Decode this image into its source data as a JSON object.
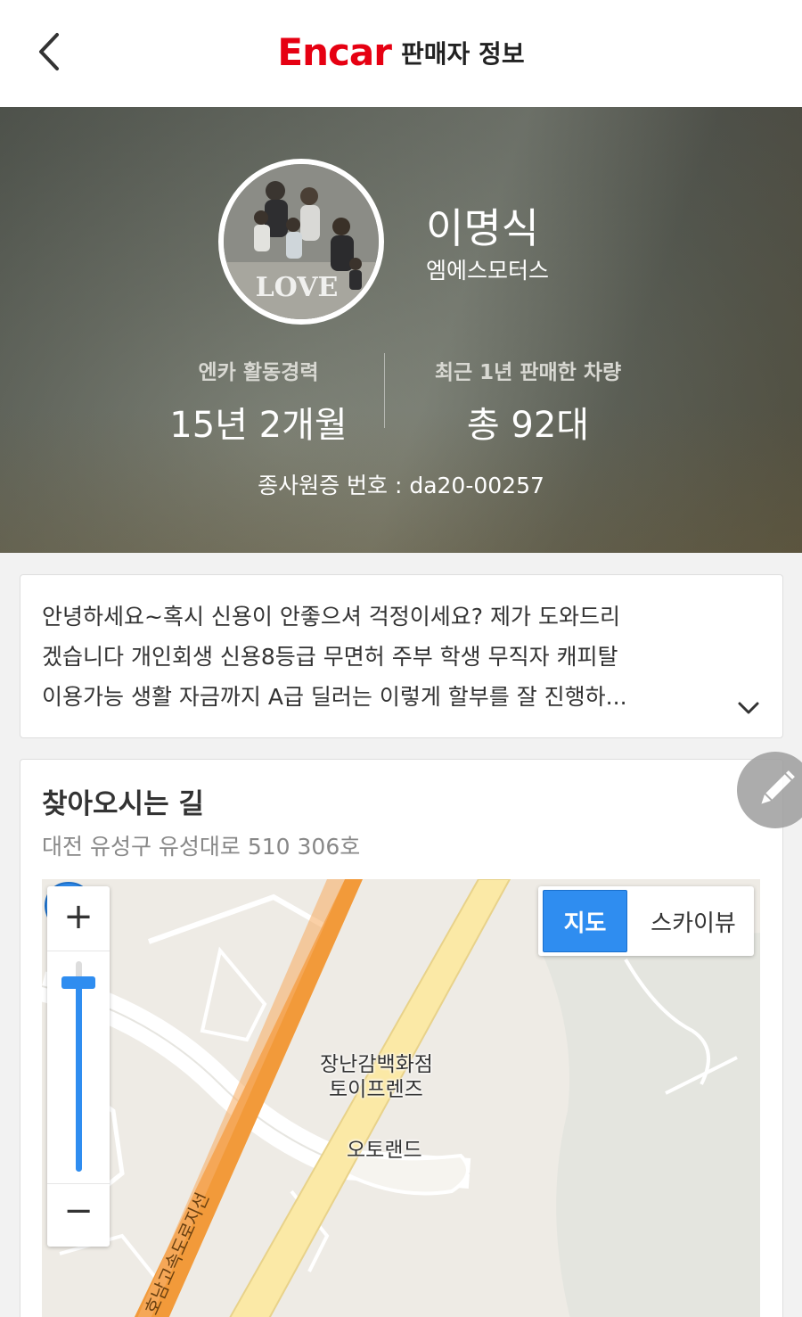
{
  "header": {
    "logo": "Encar",
    "title": "판매자 정보"
  },
  "seller": {
    "name": "이명식",
    "dealer": "엠에스모터스",
    "avatar_caption": "LOVE",
    "stats": [
      {
        "label": "엔카 활동경력",
        "value": "15년 2개월"
      },
      {
        "label": "최근 1년 판매한 차량",
        "value": "총 92대"
      }
    ],
    "license": "종사원증 번호 : da20-00257"
  },
  "intro": {
    "lines": [
      "안녕하세요~혹시 신용이 안좋으셔 걱정이세요? 제가 도와드리",
      "겠습니다 개인회생 신용8등급 무면허 주부 학생 무직자 캐피탈",
      "이용가능 생활 자금까지 A급 딜러는 이렇게 할부를 잘 진행하..."
    ]
  },
  "location": {
    "title": "찾아오시는 길",
    "address": "대전 유성구 유성대로 510 306호",
    "map": {
      "zoom_in": "+",
      "zoom_out": "−",
      "zoom_level": 0.9,
      "types": [
        "지도",
        "스카이뷰"
      ],
      "selected_type": "지도",
      "poi": [
        "장난감백화점",
        "토이프렌즈",
        "오토랜드"
      ],
      "road_label": "호남고속도로지선"
    }
  },
  "colors": {
    "brand": "#e60012",
    "accent": "#2f8df0",
    "highway": "#f29a3a",
    "road": "#fbe9a6"
  },
  "icons": [
    "back-arrow-icon",
    "chevron-down-icon",
    "map-marker-icon",
    "pencil-icon"
  ]
}
